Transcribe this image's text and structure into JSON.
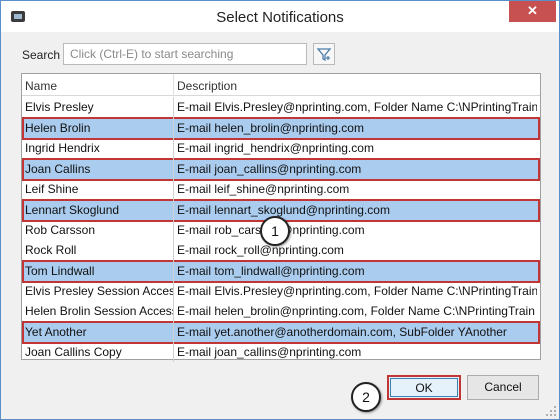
{
  "window": {
    "title": "Select Notifications",
    "close_label": "✕"
  },
  "search": {
    "label": "Search",
    "placeholder": "Click (Ctrl-E) to start searching"
  },
  "table": {
    "columns": [
      "Name",
      "Description"
    ],
    "rows": [
      {
        "name": "Elvis Presley",
        "desc": "E-mail Elvis.Presley@nprinting.com, Folder Name C:\\NPrintingTraini",
        "selected": false
      },
      {
        "name": "Helen Brolin",
        "desc": "E-mail helen_brolin@nprinting.com",
        "selected": true
      },
      {
        "name": "Ingrid Hendrix",
        "desc": "E-mail ingrid_hendrix@nprinting.com",
        "selected": false
      },
      {
        "name": "Joan Callins",
        "desc": "E-mail joan_callins@nprinting.com",
        "selected": true
      },
      {
        "name": "Leif Shine",
        "desc": "E-mail leif_shine@nprinting.com",
        "selected": false
      },
      {
        "name": "Lennart Skoglund",
        "desc": "E-mail lennart_skoglund@nprinting.com",
        "selected": true
      },
      {
        "name": "Rob Carsson",
        "desc": "E-mail rob_carsson@nprinting.com",
        "selected": false
      },
      {
        "name": "Rock Roll",
        "desc": "E-mail rock_roll@nprinting.com",
        "selected": false
      },
      {
        "name": "Tom Lindwall",
        "desc": "E-mail tom_lindwall@nprinting.com",
        "selected": true
      },
      {
        "name": "Elvis Presley Session Access",
        "desc": "E-mail Elvis.Presley@nprinting.com, Folder Name C:\\NPrintingTraini",
        "selected": false
      },
      {
        "name": "Helen Brolin Session Access",
        "desc": "E-mail helen_brolin@nprinting.com, Folder Name C:\\NPrintingTrain",
        "selected": false
      },
      {
        "name": "Yet Another",
        "desc": "E-mail yet.another@anotherdomain.com, SubFolder YAnother",
        "selected": true
      },
      {
        "name": "Joan Callins Copy",
        "desc": "E-mail joan_callins@nprinting.com",
        "selected": false
      }
    ]
  },
  "callouts": [
    "1",
    "2"
  ],
  "buttons": {
    "ok": "OK",
    "cancel": "Cancel"
  },
  "colors": {
    "selection": "#aaccee",
    "highlight_border": "#c23535",
    "close": "#c75050"
  },
  "icons": {
    "app": "app-icon",
    "filter": "filter-icon",
    "close": "close-icon",
    "grip": "resize-grip-icon"
  }
}
